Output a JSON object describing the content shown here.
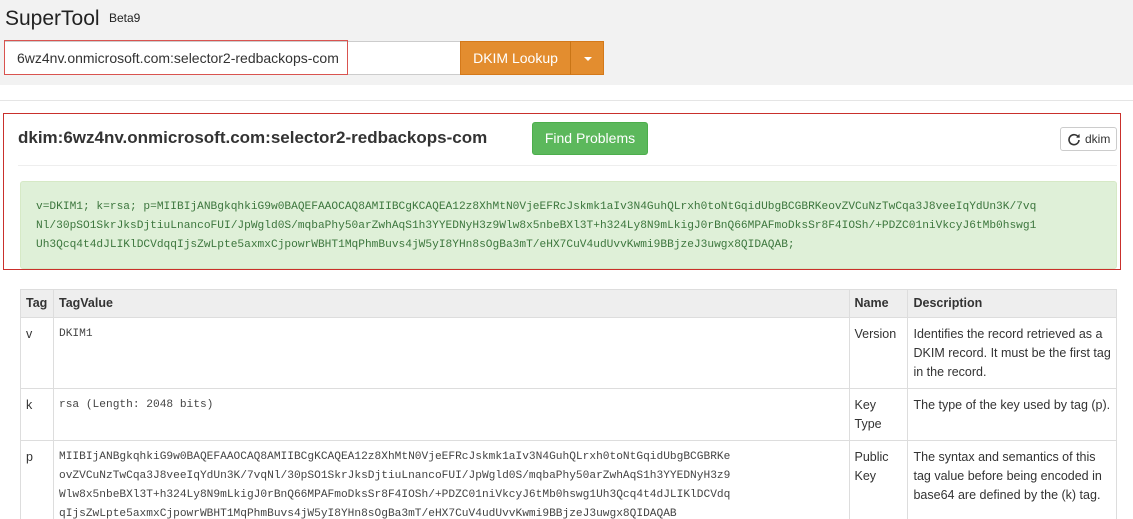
{
  "header": {
    "brand": "SuperTool",
    "beta": "Beta9"
  },
  "search": {
    "value": "6wz4nv.onmicrosoft.com:selector2-redbackops-com",
    "button_label": "DKIM Lookup"
  },
  "result": {
    "title": "dkim:6wz4nv.onmicrosoft.com:selector2-redbackops-com",
    "find_problems_label": "Find Problems",
    "refresh_label": "dkim",
    "record_lines": [
      "v=DKIM1; k=rsa; p=MIIBIjANBgkqhkiG9w0BAQEFAAOCAQ8AMIIBCgKCAQEA12z8XhMtN0VjeEFRcJskmk1aIv3N4GuhQLrxh0toNtGqidUbgBCGBRKeovZVCuNzTwCqa3J8veeIqYdUn3K/7vq",
      "Nl/30pSO1SkrJksDjtiuLnancoFUI/JpWgld0S/mqbaPhy50arZwhAqS1h3YYEDNyH3z9Wlw8x5nbeBXl3T+h324Ly8N9mLkigJ0rBnQ66MPAFmoDksSr8F4IOSh/+PDZC01niVkcyJ6tMb0hswg1",
      "Uh3Qcq4t4dJLIKlDCVdqqIjsZwLpte5axmxCjpowrWBHT1MqPhmBuvs4jW5yI8YHn8sOgBa3mT/eHX7CuV4udUvvKwmi9BBjzeJ3uwgx8QIDAQAB;"
    ]
  },
  "table": {
    "headers": [
      "Tag",
      "TagValue",
      "Name",
      "Description"
    ],
    "rows": [
      {
        "tag": "v",
        "value_lines": [
          "DKIM1"
        ],
        "name": "Version",
        "description": "Identifies the record retrieved as a DKIM record. It must be the first tag in the record."
      },
      {
        "tag": "k",
        "value_lines": [
          "rsa (Length: 2048 bits)"
        ],
        "name": "Key Type",
        "description": "The type of the key used by tag (p)."
      },
      {
        "tag": "p",
        "value_lines": [
          "MIIBIjANBgkqhkiG9w0BAQEFAAOCAQ8AMIIBCgKCAQEA12z8XhMtN0VjeEFRcJskmk1aIv3N4GuhQLrxh0toNtGqidUbgBCGBRKe",
          "ovZVCuNzTwCqa3J8veeIqYdUn3K/7vqNl/30pSO1SkrJksDjtiuLnancoFUI/JpWgld0S/mqbaPhy50arZwhAqS1h3YYEDNyH3z9",
          "Wlw8x5nbeBXl3T+h324Ly8N9mLkigJ0rBnQ66MPAFmoDksSr8F4IOSh/+PDZC01niVkcyJ6tMb0hswg1Uh3Qcq4t4dJLIKlDCVdq",
          "qIjsZwLpte5axmxCjpowrWBHT1MqPhmBuvs4jW5yI8YHn8sOgBa3mT/eHX7CuV4udUvvKwmi9BBjzeJ3uwgx8QIDAQAB"
        ],
        "name": "Public Key",
        "description": "The syntax and semantics of this tag value before being encoded in base64 are defined by the (k) tag."
      }
    ]
  }
}
